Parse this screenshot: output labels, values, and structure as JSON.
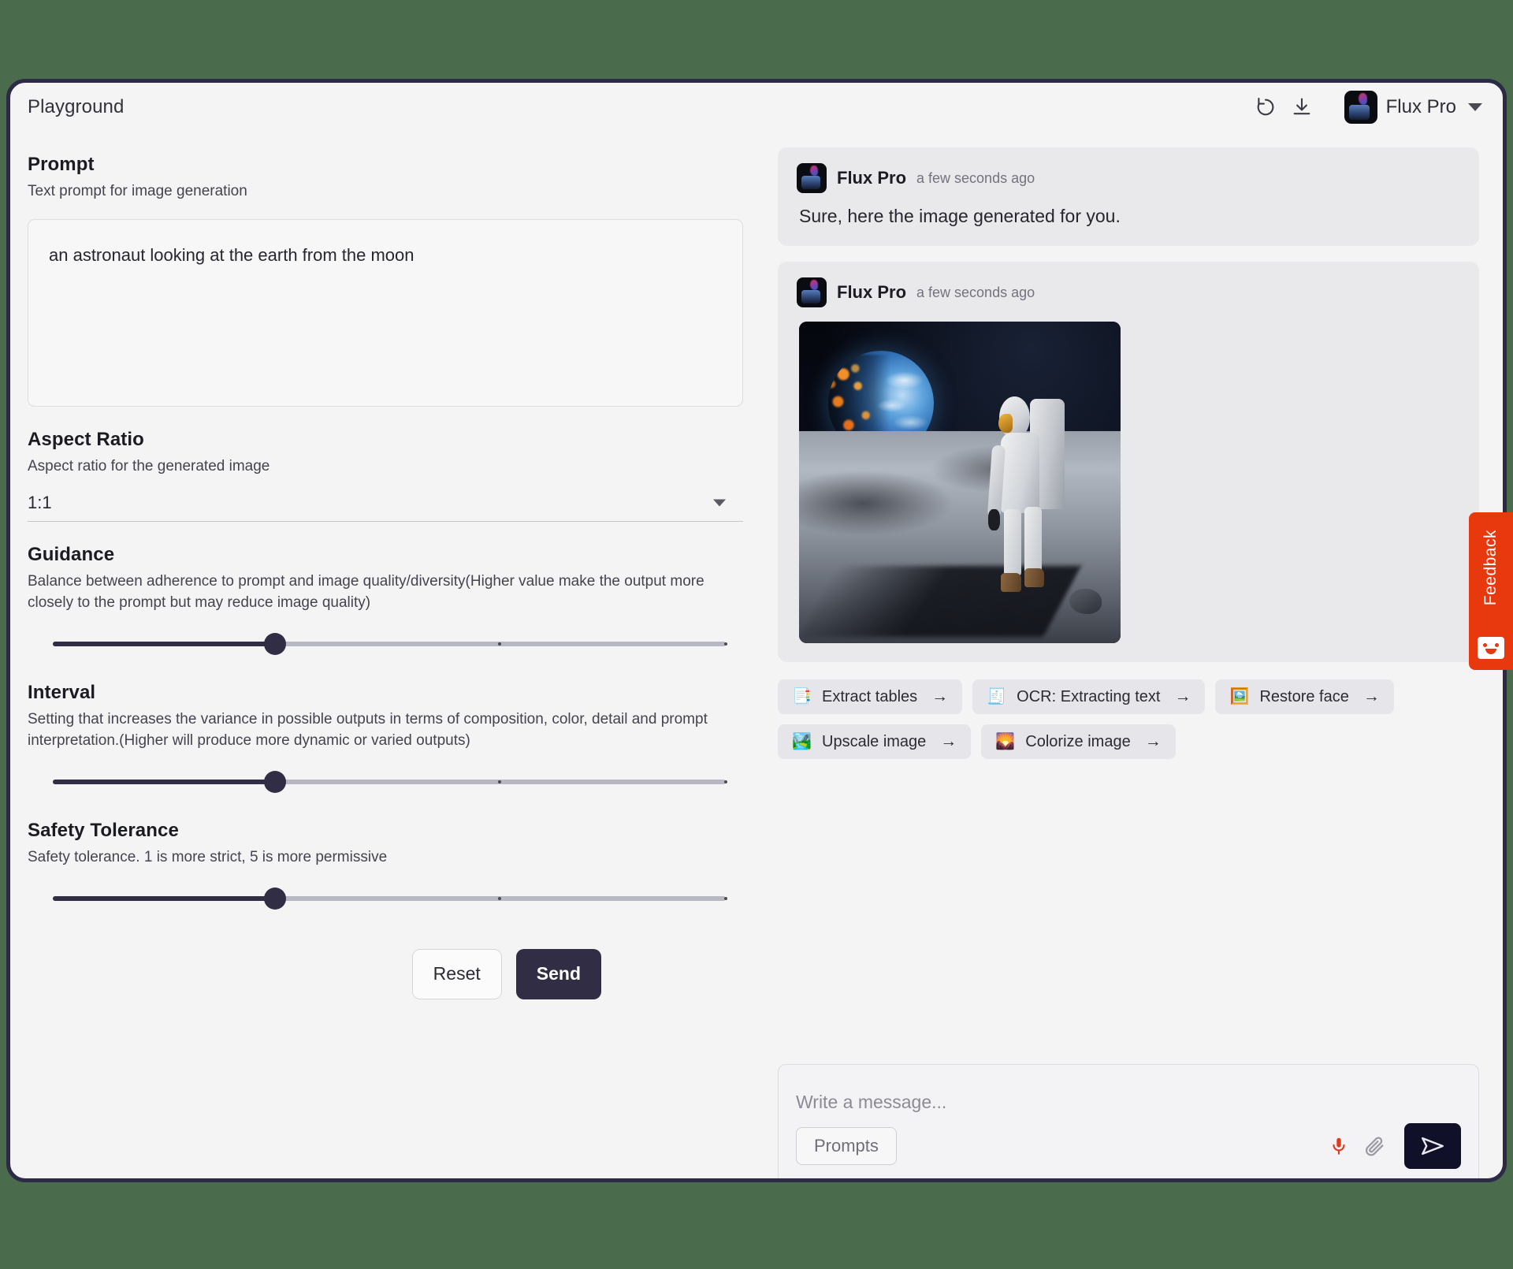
{
  "header": {
    "title": "Playground",
    "refresh_icon": "refresh-icon",
    "download_icon": "download-icon",
    "model_name": "Flux Pro",
    "chevron_icon": "chevron-down-icon"
  },
  "params": {
    "prompt": {
      "title": "Prompt",
      "description": "Text prompt for image generation",
      "value": "an astronaut looking at the earth from the moon",
      "placeholder": ""
    },
    "aspect_ratio": {
      "title": "Aspect Ratio",
      "description": "Aspect ratio for the generated image",
      "value": "1:1"
    },
    "guidance": {
      "title": "Guidance",
      "description": "Balance between adherence to prompt and image quality/diversity(Higher value make the output more closely to the prompt but may reduce image quality)",
      "percent": 33
    },
    "interval": {
      "title": "Interval",
      "description": "Setting that increases the variance in possible outputs in terms of composition, color, detail and prompt interpretation.(Higher will produce more dynamic or varied outputs)",
      "percent": 33
    },
    "safety_tolerance": {
      "title": "Safety Tolerance",
      "description": "Safety tolerance. 1 is more strict, 5 is more permissive",
      "percent": 33
    },
    "reset_label": "Reset",
    "send_label": "Send"
  },
  "chat": {
    "messages": [
      {
        "author": "Flux Pro",
        "time": "a few seconds ago",
        "text": "Sure, here the image generated for you.",
        "has_image": false
      },
      {
        "author": "Flux Pro",
        "time": "a few seconds ago",
        "text": "",
        "has_image": true,
        "image_alt": "an astronaut standing on the moon looking at the earth"
      }
    ],
    "quick_actions": [
      {
        "emoji": "📑",
        "label": "Extract tables",
        "arrow": "→",
        "icon": "extract-tables-icon"
      },
      {
        "emoji": "🧾",
        "label": "OCR: Extracting text",
        "arrow": "→",
        "icon": "ocr-icon"
      },
      {
        "emoji": "🖼️",
        "label": "Restore face",
        "arrow": "→",
        "icon": "restore-face-icon"
      },
      {
        "emoji": "🏞️",
        "label": "Upscale image",
        "arrow": "→",
        "icon": "upscale-image-icon"
      },
      {
        "emoji": "🌄",
        "label": "Colorize image",
        "arrow": "→",
        "icon": "colorize-image-icon"
      }
    ]
  },
  "composer": {
    "placeholder": "Write a message...",
    "value": "",
    "prompts_label": "Prompts",
    "mic_icon": "microphone-icon",
    "attach_icon": "paperclip-icon",
    "send_icon": "send-icon"
  },
  "feedback": {
    "label": "Feedback",
    "icon": "smiley-face-icon"
  },
  "colors": {
    "page_background": "#4a6b4c",
    "window_border": "#2d2a45",
    "panel_background": "#f4f4f5",
    "accent": "#302d45",
    "feedback": "#e8380d",
    "mic": "#e03a20"
  }
}
